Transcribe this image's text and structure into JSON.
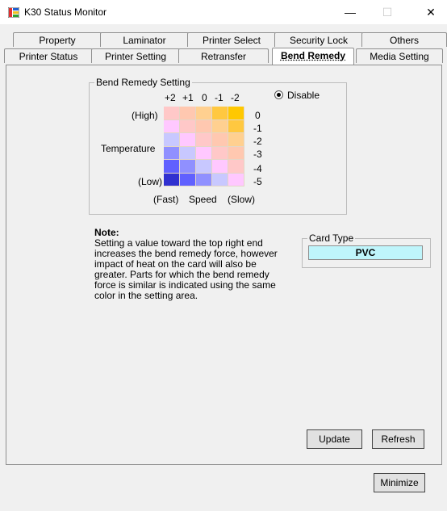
{
  "window": {
    "title": "K30 Status Monitor",
    "minimize_glyph": "—",
    "maximize_glyph": "☐",
    "close_glyph": "✕"
  },
  "tabs_top": [
    "Property",
    "Laminator",
    "Printer Select",
    "Security Lock",
    "Others"
  ],
  "tabs_bottom": [
    "Printer Status",
    "Printer Setting",
    "Retransfer",
    "Bend Remedy",
    "Media Setting"
  ],
  "active_tab": "Bend Remedy",
  "bend_remedy": {
    "group_label": "Bend Remedy Setting",
    "column_headers": [
      "+2",
      "+1",
      "0",
      "-1",
      "-2"
    ],
    "row_values": [
      "0",
      "-1",
      "-2",
      "-3",
      "-4",
      "-5"
    ],
    "high_label": "(High)",
    "temperature_label": "Temperature",
    "low_label": "(Low)",
    "fast_label": "(Fast)",
    "speed_label": "Speed",
    "slow_label": "(Slow)",
    "disable_label": "Disable",
    "disable_selected": true,
    "grid_colors": [
      [
        "#ffc8c8",
        "#ffc8b0",
        "#ffd090",
        "#ffc840",
        "#ffc800"
      ],
      [
        "#ffc8ff",
        "#ffc8c8",
        "#ffc8b0",
        "#ffd090",
        "#ffc840"
      ],
      [
        "#c8c8ff",
        "#ffc8ff",
        "#ffc8c8",
        "#ffc8b0",
        "#ffd090"
      ],
      [
        "#9090ff",
        "#c8c8ff",
        "#ffc8ff",
        "#ffc8c8",
        "#ffc8b0"
      ],
      [
        "#6060ff",
        "#9090ff",
        "#c8c8ff",
        "#ffc8ff",
        "#ffc8c8"
      ],
      [
        "#3030d0",
        "#6060ff",
        "#9090ff",
        "#c8c8ff",
        "#ffc8ff"
      ]
    ]
  },
  "note": {
    "title": "Note:",
    "text": "Setting a value toward the top right end increases the bend remedy force, however impact of heat on the card will also be greater.  Parts for which the bend remedy force is similar is indicated using the same color in the setting area."
  },
  "card_type": {
    "label": "Card Type",
    "value": "PVC"
  },
  "buttons": {
    "update": "Update",
    "refresh": "Refresh",
    "minimize": "Minimize"
  }
}
